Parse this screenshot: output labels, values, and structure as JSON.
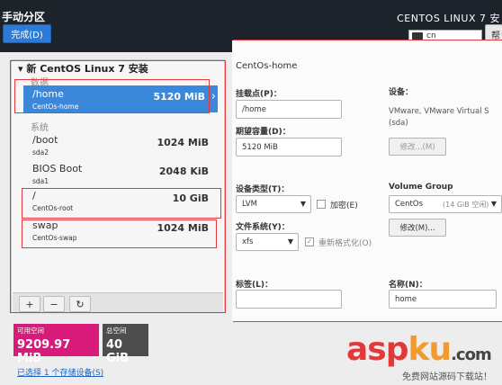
{
  "header": {
    "title": "手动分区",
    "done_label": "完成(D)",
    "product": "CENTOS LINUX 7 安",
    "keyboard_layout": "cn",
    "help_label": "帮"
  },
  "left": {
    "install_title": "新 CentOS Linux 7 安装",
    "groups": {
      "data": "数据",
      "system": "系统"
    },
    "mountpoints": [
      {
        "name": "/home",
        "device": "CentOs-home",
        "size": "5120 MiB"
      },
      {
        "name": "/boot",
        "device": "sda2",
        "size": "1024 MiB"
      },
      {
        "name": "BIOS Boot",
        "device": "sda1",
        "size": "2048 KiB"
      },
      {
        "name": "/",
        "device": "CentOs-root",
        "size": "10 GiB"
      },
      {
        "name": "swap",
        "device": "CentOs-swap",
        "size": "1024 MiB"
      }
    ],
    "toolbar": {
      "add": "+",
      "remove": "−",
      "refresh": "↻"
    },
    "available": {
      "label": "可用空间",
      "value": "9209.97 MiB",
      "color": "#d81b7a"
    },
    "total": {
      "label": "总空间",
      "value": "40 GiB",
      "color": "#4d4d4d"
    },
    "storage_link": "已选择 1 个存储设备(S)"
  },
  "right": {
    "title": "CentOs-home",
    "mount_label": "挂载点(P)：",
    "mount_value": "/home",
    "capacity_label": "期望容量(D)：",
    "capacity_value": "5120 MiB",
    "device_label": "设备：",
    "device_text": "VMware, VMware Virtual S",
    "device_text2": "(sda)",
    "modify_disabled": "修改...(M)",
    "type_label": "设备类型(T)：",
    "type_value": "LVM",
    "encrypt_label": "加密(E)",
    "fs_label": "文件系统(Y)：",
    "fs_value": "xfs",
    "reformat_label": "重新格式化(O)",
    "vg_label": "Volume Group",
    "vg_value": "CentOs",
    "vg_free": "(14 GiB 空闲)",
    "modify": "修改(M)...",
    "tag_label": "标签(L)：",
    "tag_value": "",
    "name_label": "名称(N)：",
    "name_value": "home"
  },
  "watermark": {
    "a": "asp",
    "k": "ku",
    "dot": ".com",
    "sub": "免费网站源码下载站！"
  }
}
